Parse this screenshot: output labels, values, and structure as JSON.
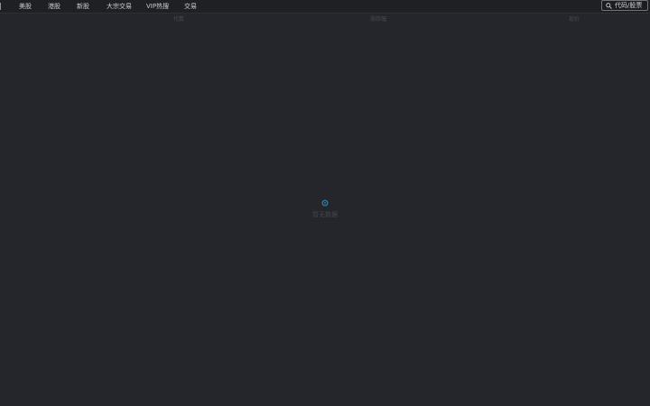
{
  "nav": {
    "items": [
      {
        "label": "美股"
      },
      {
        "label": "港股"
      },
      {
        "label": "新股"
      },
      {
        "label": "大宗交易"
      },
      {
        "label": "VIP热搜"
      },
      {
        "label": "交易"
      }
    ]
  },
  "search": {
    "placeholder": "代码/股票"
  },
  "columns": {
    "headers": [
      "代数",
      "涨跌幅",
      "现价"
    ]
  },
  "empty": {
    "message": "暂无数据"
  },
  "colors": {
    "background": "#25262b",
    "topbar": "#1f2024",
    "accent": "#2f7fb0"
  }
}
